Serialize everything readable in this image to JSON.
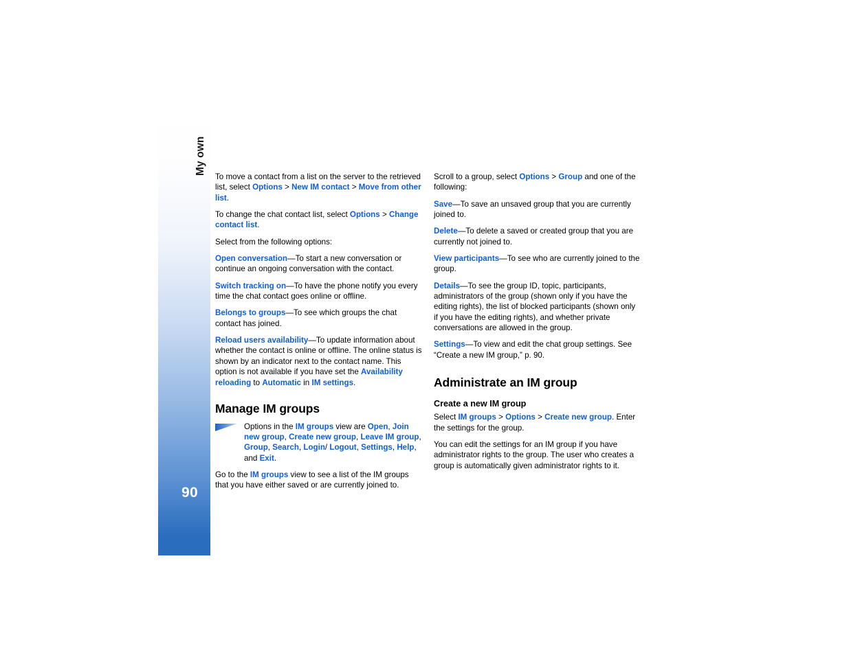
{
  "page": {
    "number": "90",
    "chapter_tab_label": "My own",
    "accent_blue": "#0f5fd6",
    "tab_gradient_bottom": "#2a6cbd"
  },
  "left_column": {
    "paragraphs": [
      {
        "id": "move-contact",
        "runs": [
          {
            "t": "To move a contact from a list on the server to the retrieved list, select ",
            "s": "plain"
          },
          {
            "t": "Options",
            "s": "link"
          },
          {
            "t": " > ",
            "s": "plain"
          },
          {
            "t": "New IM contact",
            "s": "link"
          },
          {
            "t": " > ",
            "s": "plain"
          },
          {
            "t": "Move from other list",
            "s": "link"
          },
          {
            "t": ".",
            "s": "plain"
          }
        ]
      },
      {
        "id": "change-contact-list",
        "runs": [
          {
            "t": "To change the chat contact list, select ",
            "s": "plain"
          },
          {
            "t": "Options",
            "s": "link"
          },
          {
            "t": " > ",
            "s": "plain"
          },
          {
            "t": "Change contact list",
            "s": "link"
          },
          {
            "t": ".",
            "s": "plain"
          }
        ]
      },
      {
        "id": "select-options-intro",
        "runs": [
          {
            "t": "Select from the following options:",
            "s": "plain"
          }
        ]
      },
      {
        "id": "open-conversation",
        "runs": [
          {
            "t": "Open conversation",
            "s": "link"
          },
          {
            "t": "—To start a new conversation or continue an ongoing conversation with the contact.",
            "s": "plain"
          }
        ]
      },
      {
        "id": "switch-tracking-on",
        "runs": [
          {
            "t": "Switch tracking on",
            "s": "link"
          },
          {
            "t": "—To have the phone notify you every time the chat contact goes online or offline.",
            "s": "plain"
          }
        ]
      },
      {
        "id": "belongs-to-groups",
        "runs": [
          {
            "t": "Belongs to groups",
            "s": "link"
          },
          {
            "t": "—To see which groups the chat contact has joined.",
            "s": "plain"
          }
        ]
      },
      {
        "id": "reload-users-availability",
        "runs": [
          {
            "t": "Reload users availability",
            "s": "link"
          },
          {
            "t": "—To update information about whether the contact is online or offline. The online status is shown by an indicator next to the contact name. This option is not available if you have set the ",
            "s": "plain"
          },
          {
            "t": "Availability reloading",
            "s": "link"
          },
          {
            "t": " to ",
            "s": "plain"
          },
          {
            "t": "Automatic",
            "s": "link"
          },
          {
            "t": " in ",
            "s": "plain"
          },
          {
            "t": "IM settings",
            "s": "link"
          },
          {
            "t": ".",
            "s": "plain"
          }
        ]
      }
    ],
    "heading_manage_im_groups": "Manage IM groups",
    "note": {
      "icon_name": "note-wedge-icon",
      "runs": [
        {
          "t": "Options in the ",
          "s": "plain"
        },
        {
          "t": "IM groups",
          "s": "link"
        },
        {
          "t": " view are ",
          "s": "plain"
        },
        {
          "t": "Open",
          "s": "link"
        },
        {
          "t": ", ",
          "s": "plain"
        },
        {
          "t": "Join new group",
          "s": "link"
        },
        {
          "t": ", ",
          "s": "plain"
        },
        {
          "t": "Create new group",
          "s": "link"
        },
        {
          "t": ", ",
          "s": "plain"
        },
        {
          "t": "Leave IM group",
          "s": "link"
        },
        {
          "t": ", ",
          "s": "plain"
        },
        {
          "t": "Group",
          "s": "link"
        },
        {
          "t": ", ",
          "s": "plain"
        },
        {
          "t": "Search",
          "s": "link"
        },
        {
          "t": ", ",
          "s": "plain"
        },
        {
          "t": "Login",
          "s": "link"
        },
        {
          "t": "/ ",
          "s": "plain"
        },
        {
          "t": "Logout",
          "s": "link"
        },
        {
          "t": ", ",
          "s": "plain"
        },
        {
          "t": "Settings",
          "s": "link"
        },
        {
          "t": ", ",
          "s": "plain"
        },
        {
          "t": "Help",
          "s": "link"
        },
        {
          "t": ", and ",
          "s": "plain"
        },
        {
          "t": "Exit",
          "s": "link"
        },
        {
          "t": ".",
          "s": "plain"
        }
      ]
    },
    "paragraphs_after_note": [
      {
        "id": "go-to-im-groups",
        "runs": [
          {
            "t": "Go to the ",
            "s": "plain"
          },
          {
            "t": "IM groups",
            "s": "link"
          },
          {
            "t": " view to see a list of the IM groups that you have either saved or are currently joined to.",
            "s": "plain"
          }
        ]
      }
    ]
  },
  "right_column": {
    "paragraphs": [
      {
        "id": "scroll-to-group",
        "runs": [
          {
            "t": "Scroll to a group, select ",
            "s": "plain"
          },
          {
            "t": "Options",
            "s": "link"
          },
          {
            "t": " > ",
            "s": "plain"
          },
          {
            "t": "Group",
            "s": "link"
          },
          {
            "t": " and one of the following:",
            "s": "plain"
          }
        ]
      },
      {
        "id": "save",
        "runs": [
          {
            "t": "Save",
            "s": "link"
          },
          {
            "t": "—To save an unsaved group that you are currently joined to.",
            "s": "plain"
          }
        ]
      },
      {
        "id": "delete",
        "runs": [
          {
            "t": "Delete",
            "s": "link"
          },
          {
            "t": "—To delete a saved or created group that you are currently not joined to.",
            "s": "plain"
          }
        ]
      },
      {
        "id": "view-participants",
        "runs": [
          {
            "t": "View participants",
            "s": "link"
          },
          {
            "t": "—To see who are currently joined to the group.",
            "s": "plain"
          }
        ]
      },
      {
        "id": "details",
        "runs": [
          {
            "t": "Details",
            "s": "link"
          },
          {
            "t": "—To see the group ID, topic, participants, administrators of the group (shown only if you have the editing rights), the list of blocked participants (shown only if you have the editing rights), and whether private conversations are allowed in the group.",
            "s": "plain"
          }
        ]
      },
      {
        "id": "settings",
        "runs": [
          {
            "t": "Settings",
            "s": "link"
          },
          {
            "t": "—To view and edit the chat group settings. See “Create a new IM group,” p. 90.",
            "s": "plain"
          }
        ]
      }
    ],
    "heading_administrate": "Administrate an IM group",
    "subheading_create_new": "Create a new IM group",
    "paragraphs_after_subheading": [
      {
        "id": "select-create-new-group",
        "runs": [
          {
            "t": "Select ",
            "s": "plain"
          },
          {
            "t": "IM groups",
            "s": "link"
          },
          {
            "t": " > ",
            "s": "plain"
          },
          {
            "t": "Options",
            "s": "link"
          },
          {
            "t": " > ",
            "s": "plain"
          },
          {
            "t": "Create new group",
            "s": "link"
          },
          {
            "t": ". Enter the settings for the group.",
            "s": "plain"
          }
        ]
      },
      {
        "id": "edit-settings-admin-rights",
        "runs": [
          {
            "t": "You can edit the settings for an IM group if you have administrator rights to the group. The user who creates a group is automatically given administrator rights to it.",
            "s": "plain"
          }
        ]
      }
    ]
  }
}
